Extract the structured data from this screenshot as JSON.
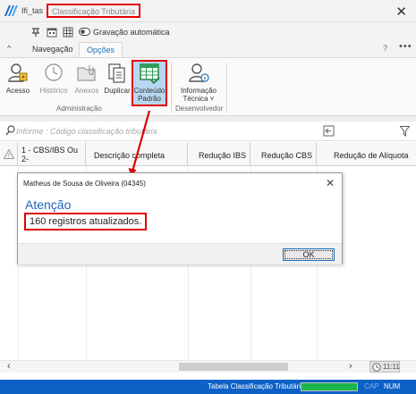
{
  "window": {
    "app_name": "Ifi_tas",
    "title": "Classificação Tributária"
  },
  "quick_access": {
    "auto_save_label": "Gravação automática"
  },
  "tabs": [
    {
      "label": "Navegação",
      "active": false
    },
    {
      "label": "Opções",
      "active": true
    }
  ],
  "help_label": "?",
  "more_label": "•••",
  "ribbon": {
    "buttons": [
      {
        "label": "Acesso",
        "icon": "user-key-icon",
        "enabled": true
      },
      {
        "label": "Histórico",
        "icon": "clock-icon",
        "enabled": false
      },
      {
        "label": "Anexos",
        "icon": "folder-attachment-icon",
        "enabled": false
      },
      {
        "label": "Duplicar",
        "icon": "duplicate-icon",
        "enabled": true
      },
      {
        "label_line1": "Conteúdo",
        "label_line2": "Padrão",
        "icon": "table-grid-icon",
        "enabled": true,
        "selected": true
      },
      {
        "label_line1": "Informação",
        "label_line2": "Técnica",
        "icon": "user-info-icon",
        "enabled": true
      }
    ],
    "groups": [
      {
        "label": "Administração"
      },
      {
        "label": "Desenvolvedor"
      }
    ]
  },
  "search": {
    "placeholder": "Informe : Código classificação tributária"
  },
  "grid": {
    "columns": [
      "1 - CBS/IBS Ou 2-",
      "Descrição completa",
      "Redução IBS",
      "Redução CBS",
      "Redução de Alíquota"
    ]
  },
  "scroll": {
    "left_arrow": "‹",
    "right_arrow": "›",
    "clock_text": "11:11"
  },
  "status": {
    "text": "Tabela Classificação Tributária",
    "progress": 1.0,
    "cap": "CAP",
    "num": "NUM"
  },
  "dialog": {
    "title": "Matheus de Sousa de Oliveira (04345)",
    "heading": "Atenção",
    "message": "160 registros atualizados.",
    "ok_label": "OK"
  },
  "colors": {
    "accent": "#1e73be",
    "highlight": "#e00000",
    "status_bar": "#0e62c7",
    "progress": "#1db54a",
    "heading_blue": "#2163b4"
  }
}
